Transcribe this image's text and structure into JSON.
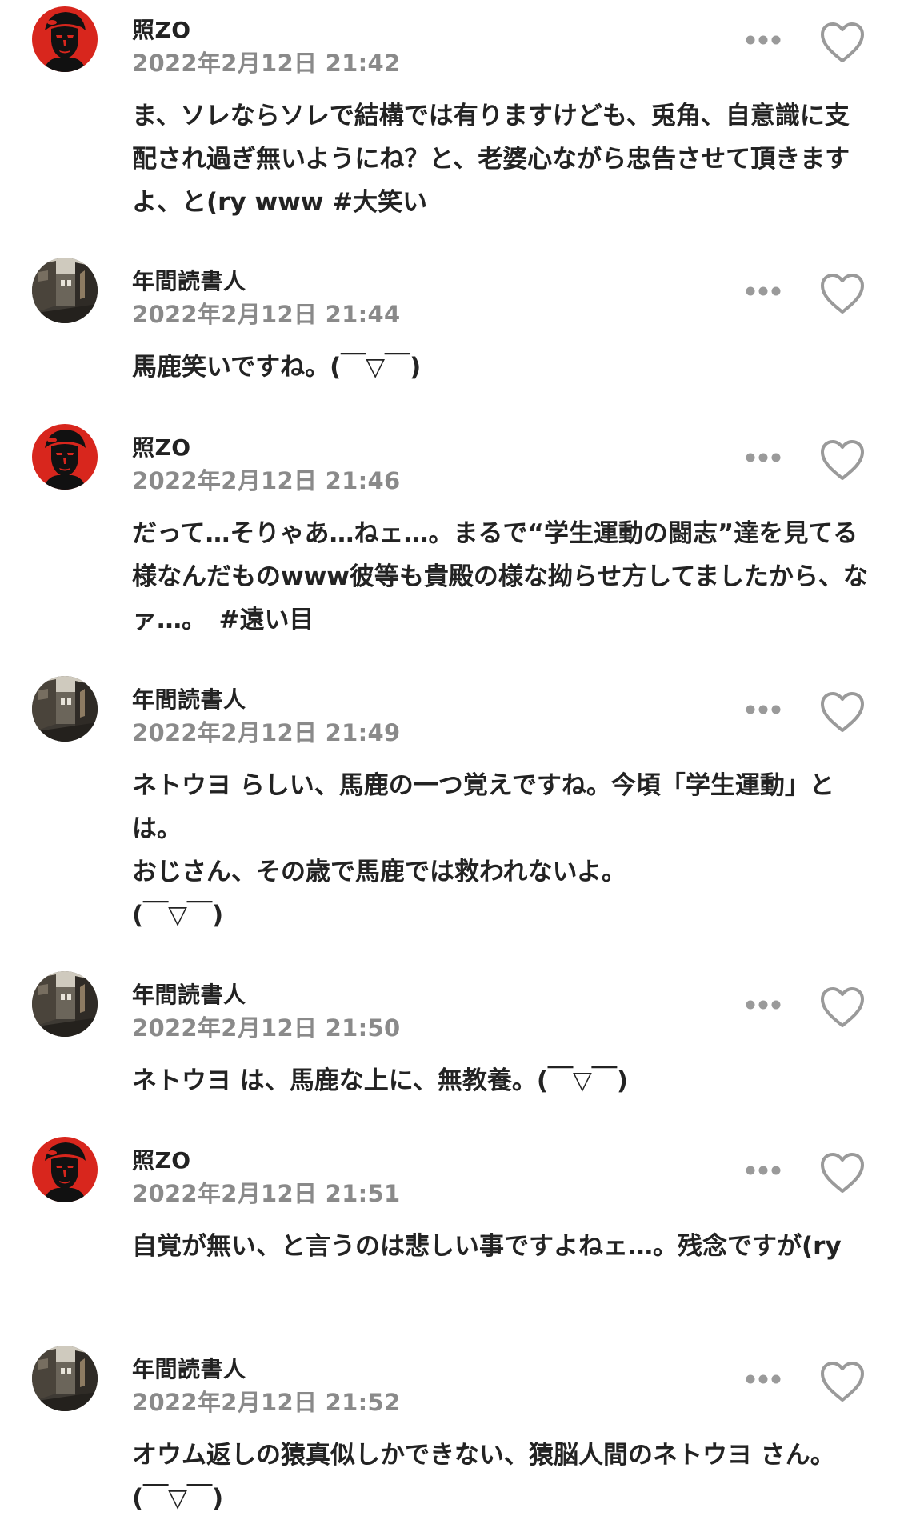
{
  "comments": [
    {
      "username": "照ZO",
      "avatar": "che-portrait-avatar",
      "timestamp": "2022年2月12日 21:42",
      "text": "ま、ソレならソレで結構では有りますけども、兎角、自意識に支配され過ぎ無いようにね？と、老婆心ながら忠告させて頂きますよ、と(ry www #大笑い"
    },
    {
      "username": "年間読書人",
      "avatar": "street-photo-avatar",
      "timestamp": "2022年2月12日 21:44",
      "text": "馬鹿笑いですね。(￣▽￣)"
    },
    {
      "username": "照ZO",
      "avatar": "che-portrait-avatar",
      "timestamp": "2022年2月12日 21:46",
      "text": "だって…そりゃあ…ねェ…。まるで“学生運動の闘志”達を見てる様なんだものwww彼等も貴殿の様な拗らせ方してましたから、なァ…。　#遠い目"
    },
    {
      "username": "年間読書人",
      "avatar": "street-photo-avatar",
      "timestamp": "2022年2月12日 21:49",
      "text": "ネトウヨ らしい、馬鹿の一つ覚えですね。今頃「学生運動」とは。\nおじさん、その歳で馬鹿では救われないよ。\n(￣▽￣)"
    },
    {
      "username": "年間読書人",
      "avatar": "street-photo-avatar",
      "timestamp": "2022年2月12日 21:50",
      "text": "ネトウヨ は、馬鹿な上に、無教養。(￣▽￣)"
    },
    {
      "username": "照ZO",
      "avatar": "che-portrait-avatar",
      "timestamp": "2022年2月12日 21:51",
      "text": "自覚が無い、と言うのは悲しい事ですよねェ…。残念ですが(ry"
    },
    {
      "username": "年間読書人",
      "avatar": "street-photo-avatar",
      "timestamp": "2022年2月12日 21:52",
      "text": "オウム返しの猿真似しかできない、猿脳人間のネトウヨ さん。(￣▽￣)"
    }
  ],
  "icons": {
    "more": "more-dots-icon",
    "like": "heart-outline-icon"
  },
  "colors": {
    "timestamp": "#8a8a8a",
    "icon": "#9a9a9a",
    "text": "#232323",
    "avatar_red": "#d8261d"
  }
}
